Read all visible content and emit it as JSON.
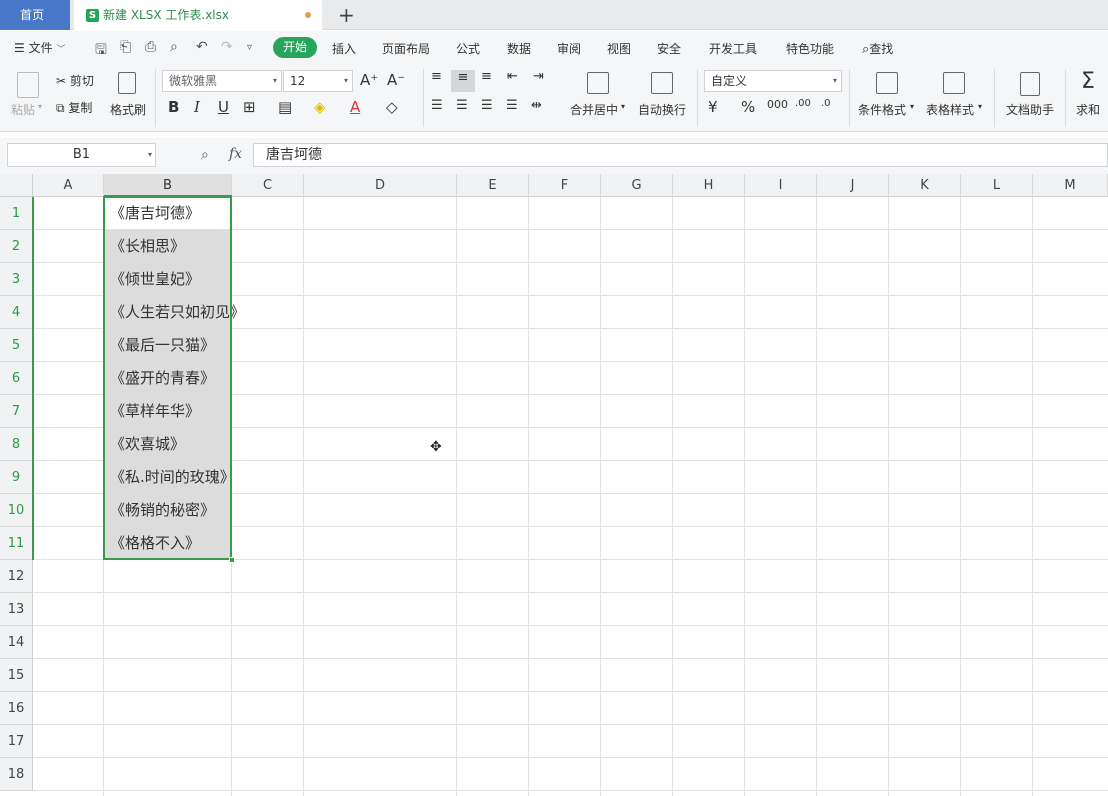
{
  "tabs": {
    "home_label": "首页",
    "file_label": "新建 XLSX 工作表.xlsx",
    "file_icon_label": "S",
    "add_label": "+"
  },
  "menu": {
    "file_label": "文件",
    "tabs": [
      "开始",
      "插入",
      "页面布局",
      "公式",
      "数据",
      "审阅",
      "视图",
      "安全",
      "开发工具",
      "特色功能"
    ],
    "search_label": "查找"
  },
  "ribbon": {
    "paste_label": "粘贴",
    "cut_label": "剪切",
    "copy_label": "复制",
    "format_painter_label": "格式刷",
    "font_name": "微软雅黑",
    "font_size": "12",
    "merge_label": "合并居中",
    "wrap_label": "自动换行",
    "number_format": "自定义",
    "conditional_format_label": "条件格式",
    "table_style_label": "表格样式",
    "doc_helper_label": "文档助手",
    "sum_label": "求和"
  },
  "formula_bar": {
    "name_box": "B1",
    "fx_label": "fx",
    "formula": "唐吉坷德"
  },
  "sheet": {
    "columns": [
      "A",
      "B",
      "C",
      "D",
      "E",
      "F",
      "G",
      "H",
      "I",
      "J",
      "K",
      "L",
      "M"
    ],
    "rows": [
      "1",
      "2",
      "3",
      "4",
      "5",
      "6",
      "7",
      "8",
      "9",
      "10",
      "11",
      "12",
      "13",
      "14",
      "15",
      "16",
      "17",
      "18"
    ],
    "column_b_values": [
      "《唐吉坷德》",
      "《长相思》",
      "《倾世皇妃》",
      "《人生若只如初见》",
      "《最后一只猫》",
      "《盛开的青春》",
      "《草样年华》",
      "《欢喜城》",
      "《私.时间的玫瑰》",
      "《畅销的秘密》",
      "《格格不入》"
    ]
  },
  "colors": {
    "accent_green": "#29a55b",
    "selection_border": "#3a9a4a",
    "home_tab_blue": "#4a78c8"
  }
}
